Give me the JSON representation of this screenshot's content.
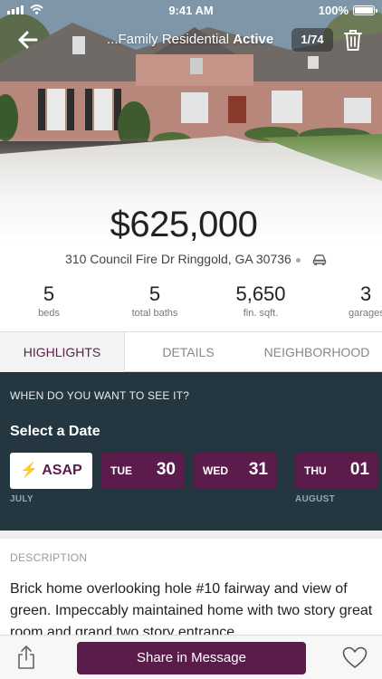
{
  "status_bar": {
    "time": "9:41 AM",
    "battery": "100%"
  },
  "nav": {
    "title": "...Family Residential",
    "status": "Active",
    "photo_counter": "1/74"
  },
  "listing": {
    "price": "$625,000",
    "address": "310 Council Fire Dr Ringgold, GA 30736"
  },
  "stats": [
    {
      "value": "5",
      "label": "beds"
    },
    {
      "value": "5",
      "label": "total baths"
    },
    {
      "value": "5,650",
      "label": "fin. sqft."
    },
    {
      "value": "3",
      "label": "garages"
    }
  ],
  "tabs": [
    {
      "label": "HIGHLIGHTS",
      "active": true
    },
    {
      "label": "DETAILS",
      "active": false
    },
    {
      "label": "NEIGHBORHOOD",
      "active": false
    }
  ],
  "schedule": {
    "question": "WHEN DO YOU WANT TO SEE IT?",
    "heading": "Select a Date",
    "asap_label": "ASAP",
    "dates": [
      {
        "dow": "TUE",
        "day": "30"
      },
      {
        "dow": "WED",
        "day": "31"
      },
      {
        "dow": "THU",
        "day": "01"
      }
    ],
    "months": [
      "JULY",
      "AUGUST"
    ]
  },
  "description": {
    "label": "DESCRIPTION",
    "text": "Brick home overlooking hole #10 fairway and view of green.  Impeccably maintained home with two story great room and grand two story entrance."
  },
  "bottom_bar": {
    "share_label": "Share in Message"
  },
  "icons": {
    "back": "back-arrow-icon",
    "trash": "trash-icon",
    "car": "car-icon",
    "bolt": "lightning-bolt-icon",
    "share": "share-icon",
    "heart": "heart-icon"
  },
  "colors": {
    "brand": "#5b1c4c",
    "panel": "#243640",
    "tab_active_text": "#5a1f4b"
  }
}
